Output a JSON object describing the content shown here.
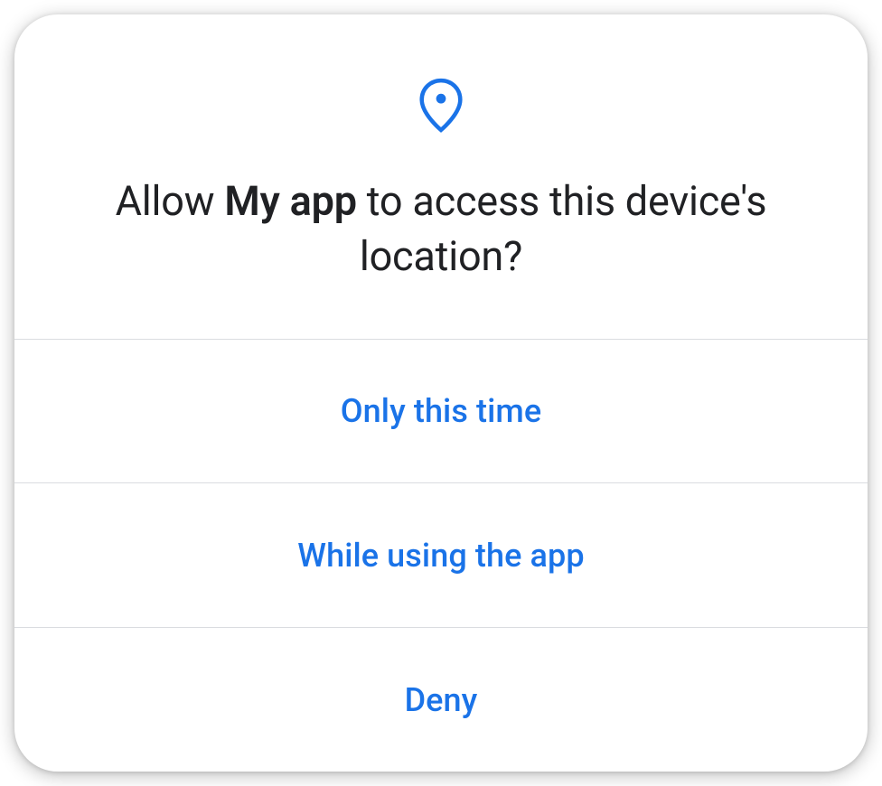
{
  "dialog": {
    "title_prefix": "Allow ",
    "app_name": "My app",
    "title_suffix": " to access this device's location?"
  },
  "options": {
    "only_this_time": "Only this time",
    "while_using": "While using the app",
    "deny": "Deny"
  },
  "colors": {
    "accent": "#1a73e8",
    "text": "#202124",
    "divider": "#dadce0"
  }
}
